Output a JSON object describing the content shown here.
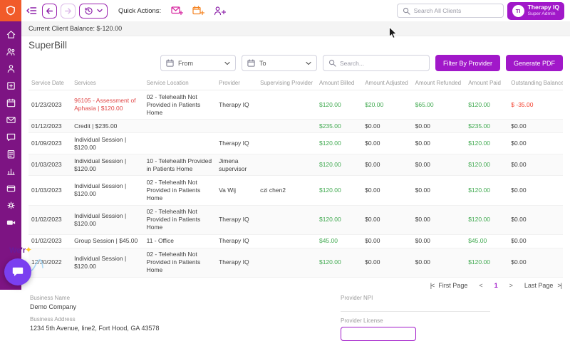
{
  "colors": {
    "sidebar_bg": "#7d1483",
    "logo_bg": "#f15b2a",
    "accent_purple": "#a118c9",
    "outline_purple": "#9c27b0",
    "positive_green": "#3fa94f",
    "negative_red": "#f4402e",
    "flagged_service_red": "#e14848"
  },
  "sidebar": {
    "icons": [
      "home",
      "clients",
      "user",
      "clinic",
      "calendar",
      "mail",
      "chat",
      "notes",
      "reports",
      "billing",
      "settings",
      "video"
    ]
  },
  "header": {
    "quick_actions_label": "Quick Actions:",
    "search_placeholder": "Search All Clients",
    "profile": {
      "initials": "TI",
      "name": "Therapy IQ",
      "role": "Super Admin"
    }
  },
  "balance_bar": {
    "text": "Current Client Balance: $-120.00"
  },
  "page": {
    "title": "SuperBill"
  },
  "filters": {
    "from_label": "From",
    "to_label": "To",
    "search_placeholder": "Search...",
    "filter_by_provider": "Filter By Provider",
    "generate_pdf": "Generate PDF"
  },
  "table": {
    "columns": [
      "Service Date",
      "Services",
      "Service Location",
      "Provider",
      "Supervising Provider",
      "Amount Billed",
      "Amount Adjusted",
      "Amount Refunded",
      "Amount Paid",
      "Outstanding Balance"
    ],
    "rows": [
      {
        "date": "01/23/2023",
        "services": "96105 - Assessment of Aphasia | $120.00",
        "location": "02 - Telehealth Not Provided in Patients Home",
        "provider": "Therapy IQ",
        "supervising": "",
        "billed": "$120.00",
        "adjusted": "$20.00",
        "refunded": "$65.00",
        "paid": "$120.00",
        "balance": "$ -35.00",
        "flagged": true
      },
      {
        "date": "01/12/2023",
        "services": "Credit | $235.00",
        "location": "",
        "provider": "",
        "supervising": "",
        "billed": "$235.00",
        "adjusted": "$0.00",
        "refunded": "$0.00",
        "paid": "$235.00",
        "balance": "$0.00"
      },
      {
        "date": "01/09/2023",
        "services": "Individual Session | $120.00",
        "location": "",
        "provider": "Therapy IQ",
        "supervising": "",
        "billed": "$120.00",
        "adjusted": "$0.00",
        "refunded": "$0.00",
        "paid": "$120.00",
        "balance": "$0.00"
      },
      {
        "date": "01/03/2023",
        "services": "Individual Session | $120.00",
        "location": "10 - Telehealth Provided in Patients Home",
        "provider": "Jimena supervisor",
        "supervising": "",
        "billed": "$120.00",
        "adjusted": "$0.00",
        "refunded": "$0.00",
        "paid": "$120.00",
        "balance": "$0.00"
      },
      {
        "date": "01/03/2023",
        "services": "Individual Session | $120.00",
        "location": "02 - Telehealth Not Provided in Patients Home",
        "provider": "Va Wij",
        "supervising": "czi chen2",
        "billed": "$120.00",
        "adjusted": "$0.00",
        "refunded": "$0.00",
        "paid": "$120.00",
        "balance": "$0.00"
      },
      {
        "date": "01/02/2023",
        "services": "Individual Session | $120.00",
        "location": "02 - Telehealth Not Provided in Patients Home",
        "provider": "Therapy IQ",
        "supervising": "",
        "billed": "$120.00",
        "adjusted": "$0.00",
        "refunded": "$0.00",
        "paid": "$120.00",
        "balance": "$0.00"
      },
      {
        "date": "01/02/2023",
        "services": "Group Session | $45.00",
        "location": "11 - Office",
        "provider": "Therapy IQ",
        "supervising": "",
        "billed": "$45.00",
        "adjusted": "$0.00",
        "refunded": "$0.00",
        "paid": "$45.00",
        "balance": "$0.00"
      },
      {
        "date": "12/30/2022",
        "services": "Individual Session | $120.00",
        "location": "02 - Telehealth Not Provided in Patients Home",
        "provider": "Therapy IQ",
        "supervising": "",
        "billed": "$120.00",
        "adjusted": "$0.00",
        "refunded": "$0.00",
        "paid": "$120.00",
        "balance": "$0.00"
      }
    ]
  },
  "pagination": {
    "first_icon": "|<",
    "first_label": "First Page",
    "prev": "<",
    "current": "1",
    "next": ">",
    "last_label": "Last Page",
    "last_icon": ">|"
  },
  "footer": {
    "business_name_label": "Business Name",
    "business_name_value": "Demo Company",
    "business_address_label": "Business Address",
    "business_address_value": "1234 5th Avenue, line2, Fort Hood, GA 43578",
    "provider_npi_label": "Provider NPI",
    "provider_license_label": "Provider License"
  },
  "chat_widget": {
    "teaser": "We'r"
  }
}
